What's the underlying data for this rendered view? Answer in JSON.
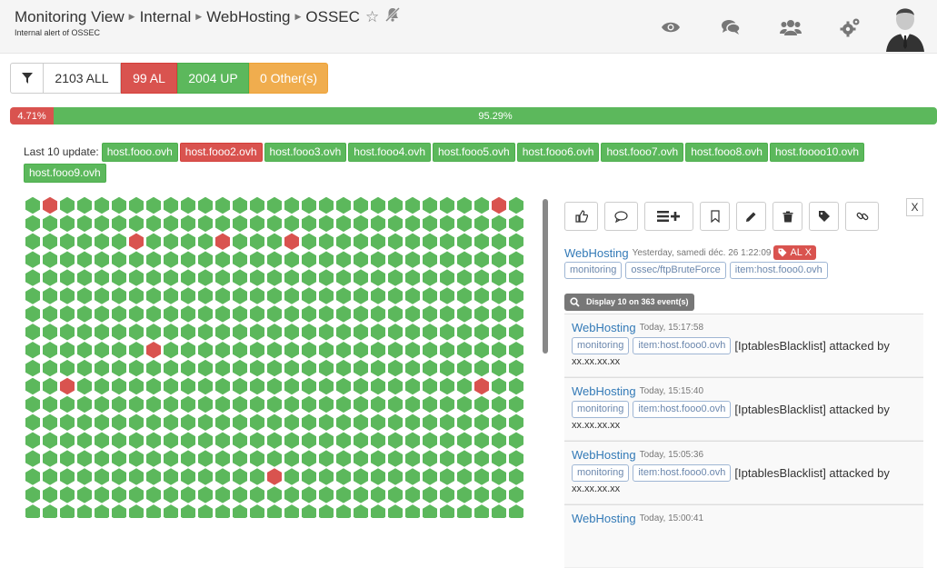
{
  "header": {
    "breadcrumb": [
      "Monitoring View",
      "Internal",
      "WebHosting",
      "OSSEC"
    ],
    "subtitle": "Internal alert of OSSEC",
    "icons": [
      "eye-icon",
      "comments-icon",
      "users-icon",
      "gears-icon",
      "avatar"
    ]
  },
  "filters": {
    "all": "2103 ALL",
    "al": "99 AL",
    "up": "2004 UP",
    "other": "0 Other(s)"
  },
  "progress": {
    "red_label": "4.71%",
    "green_label": "95.29%",
    "red_fraction": 0.0471,
    "green_fraction": 0.9529
  },
  "last_update": {
    "label": "Last 10 update:",
    "hosts": [
      {
        "name": "host.fooo.ovh",
        "status": "green"
      },
      {
        "name": "host.fooo2.ovh",
        "status": "red"
      },
      {
        "name": "host.fooo3.ovh",
        "status": "green"
      },
      {
        "name": "host.fooo4.ovh",
        "status": "green"
      },
      {
        "name": "host.fooo5.ovh",
        "status": "green"
      },
      {
        "name": "host.fooo6.ovh",
        "status": "green"
      },
      {
        "name": "host.fooo7.ovh",
        "status": "green"
      },
      {
        "name": "host.fooo8.ovh",
        "status": "green"
      },
      {
        "name": "host.foooo10.ovh",
        "status": "green"
      },
      {
        "name": "host.fooo9.ovh",
        "status": "green"
      }
    ]
  },
  "hex_grid": {
    "columns": 29,
    "rows": 18,
    "red_cells": [
      [
        0,
        1
      ],
      [
        0,
        27
      ],
      [
        2,
        6
      ],
      [
        2,
        11
      ],
      [
        2,
        15
      ],
      [
        8,
        7
      ],
      [
        10,
        2
      ],
      [
        10,
        26
      ],
      [
        15,
        14
      ]
    ],
    "colors": {
      "ok": "#5cb85c",
      "alert": "#d9534f"
    }
  },
  "detail": {
    "close_label": "X",
    "toolbar": [
      "thumbs-up-icon",
      "comment-icon",
      "add-list-icon",
      "bookmark-icon",
      "pencil-icon",
      "trash-icon",
      "tag-icon",
      "link-icon"
    ],
    "service": "WebHosting",
    "date": "Yesterday, samedi déc. 26 1:22:09",
    "badge": "AL X",
    "chips": [
      "monitoring",
      "ossec/ftpBruteForce",
      "item:host.fooo0.ovh"
    ],
    "display_label": "Display 10 on 363 event(s)",
    "events": [
      {
        "service": "WebHosting",
        "date": "Today, 15:17:58",
        "chips": [
          "monitoring",
          "item:host.fooo0.ovh"
        ],
        "text": "[IptablesBlacklist] attacked by",
        "text2": "xx.xx.xx.xx"
      },
      {
        "service": "WebHosting",
        "date": "Today, 15:15:40",
        "chips": [
          "monitoring",
          "item:host.fooo0.ovh"
        ],
        "text": "[IptablesBlacklist] attacked by",
        "text2": "xx.xx.xx.xx"
      },
      {
        "service": "WebHosting",
        "date": "Today, 15:05:36",
        "chips": [
          "monitoring",
          "item:host.fooo0.ovh"
        ],
        "text": "[IptablesBlacklist] attacked by",
        "text2": "xx.xx.xx.xx"
      },
      {
        "service": "WebHosting",
        "date": "Today, 15:00:41",
        "chips": [],
        "text": "",
        "text2": ""
      }
    ]
  }
}
